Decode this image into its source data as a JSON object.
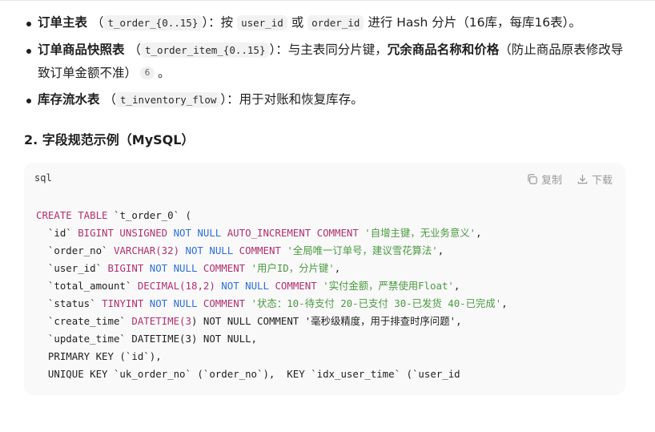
{
  "bullets": [
    {
      "title": "订单主表",
      "open": "（",
      "code": "t_order_{0..15}",
      "close": "）：",
      "text1": "按",
      "code2": "user_id",
      "text2": "或",
      "code3": "order_id",
      "text3": "进行 Hash 分片（16库，每库16表）。"
    },
    {
      "title": "订单商品快照表",
      "open": "（",
      "code": "t_order_item_{0..15}",
      "close": "）：",
      "text1": "与主表同分片键，",
      "bold2": "冗余商品名称和价格",
      "text2": "（防止商品原表修改导致订单金额不准）",
      "cite": "6",
      "text3": "。"
    },
    {
      "title": "库存流水表",
      "open": "（",
      "code": "t_inventory_flow",
      "close": "）：",
      "text1": "用于对账和恢复库存。"
    }
  ],
  "section_heading": "2. 字段规范示例（MySQL）",
  "codeblock": {
    "language": "sql",
    "copy_label": "复制",
    "download_label": "下载",
    "tokens": {
      "l1_a": "CREATE TABLE",
      "l1_b": " `t_order_0` (",
      "l2_a": "  `id` ",
      "l2_b": "BIGINT UNSIGNED ",
      "l2_c": "NOT NULL ",
      "l2_d": "AUTO_INCREMENT COMMENT ",
      "l2_e": "'自增主键，无业务意义'",
      "l2_f": ",",
      "l3_a": "  `order_no` ",
      "l3_b": "VARCHAR(",
      "l3_c": "32",
      "l3_d": ") ",
      "l3_e": "NOT NULL ",
      "l3_f": "COMMENT ",
      "l3_g": "'全局唯一订单号，建议雪花算法'",
      "l3_h": ",",
      "l4_a": "  `user_id` ",
      "l4_b": "BIGINT ",
      "l4_c": "NOT NULL ",
      "l4_d": "COMMENT ",
      "l4_e": "'用户ID，分片键'",
      "l4_f": ",",
      "l5_a": "  `total_amount` ",
      "l5_b": "DECIMAL(",
      "l5_c": "18",
      "l5_d": ",",
      "l5_e": "2",
      "l5_f": ") ",
      "l5_g": "NOT NULL ",
      "l5_h": "COMMENT ",
      "l5_i": "'实付金额，严禁使用Float'",
      "l5_j": ",",
      "l6_a": "  `status` ",
      "l6_b": "TINYINT ",
      "l6_c": "NOT NULL ",
      "l6_d": "COMMENT ",
      "l6_e": "'状态：10-待支付 20-已支付 30-已发货 40-已完成'",
      "l6_f": ",",
      "l7_a": "  `create_time` ",
      "l7_b": "DATETIME(",
      "l7_c": "3",
      "l7_d": ") NOT NULL COMMENT '毫秒级精度，用于排查时序问题',",
      "l8": "  `update_time` DATETIME(3) NOT NULL,",
      "l9": "  PRIMARY KEY (`id`),",
      "l10": "  UNIQUE KEY `uk_order_no` (`order_no`),  KEY `idx_user_time` (`user_id"
    }
  }
}
